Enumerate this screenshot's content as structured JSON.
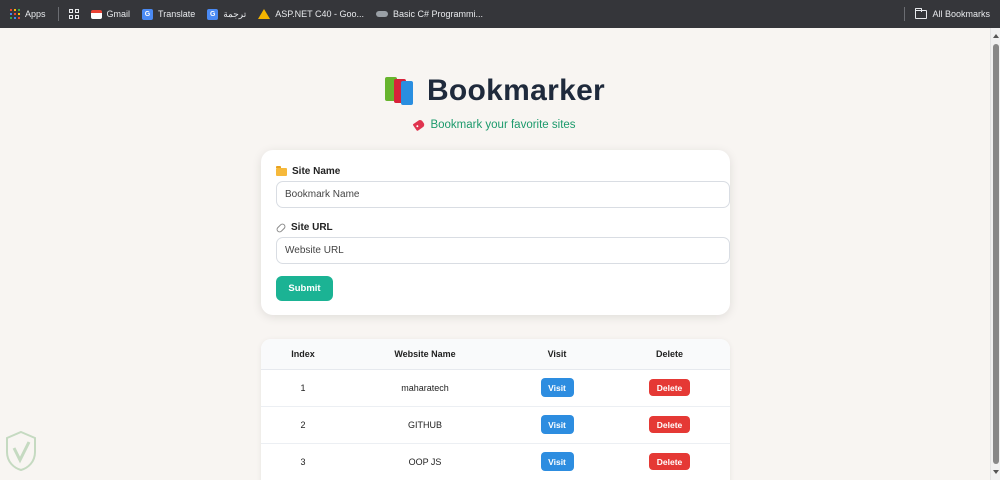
{
  "bookmarks_bar": {
    "items": [
      {
        "label": "Apps",
        "icon": "apps-grid-icon"
      },
      {
        "label": "",
        "icon": "tab-groups-icon"
      },
      {
        "label": "Gmail",
        "icon": "gmail-icon"
      },
      {
        "label": "Translate",
        "icon": "google-translate-icon"
      },
      {
        "label": "ترجمة",
        "icon": "google-translate-icon"
      },
      {
        "label": "ASP.NET C40 - Goo...",
        "icon": "google-drive-icon"
      },
      {
        "label": "Basic C# Programmi...",
        "icon": "cloud-icon"
      }
    ],
    "all_bookmarks": "All Bookmarks"
  },
  "header": {
    "title": "Bookmarker",
    "logo_icon": "books-icon",
    "subtitle": "Bookmark your favorite sites",
    "subtitle_icon": "bookmark-tag-icon",
    "accent_color": "#1c9a6c"
  },
  "form": {
    "site_name_label": "Site Name",
    "site_name_placeholder": "Bookmark Name",
    "site_url_label": "Site URL",
    "site_url_placeholder": "Website URL",
    "submit_label": "Submit",
    "submit_color": "#1bb394"
  },
  "table": {
    "columns": [
      "Index",
      "Website Name",
      "Visit",
      "Delete"
    ],
    "rows": [
      {
        "index": "1",
        "name": "maharatech",
        "visit": "Visit",
        "delete": "Delete"
      },
      {
        "index": "2",
        "name": "GITHUB",
        "visit": "Visit",
        "delete": "Delete"
      },
      {
        "index": "3",
        "name": "OOP JS",
        "visit": "Visit",
        "delete": "Delete"
      }
    ],
    "visit_color": "#2d8de0",
    "delete_color": "#e53935"
  }
}
